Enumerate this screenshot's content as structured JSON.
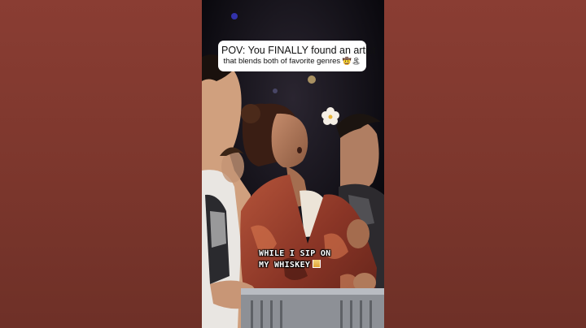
{
  "caption_top": {
    "line1": "POV: You FINALLY found an artist",
    "line2": "that blends both of favorite genres",
    "emoji_1": "🤠",
    "emoji_2": "🏝"
  },
  "caption_bottom": {
    "line1": "WHILE I SIP ON",
    "line2": "MY WHISKEY",
    "emoji": "🥃"
  },
  "colors": {
    "side_panel": "#7d372d",
    "caption_bg": "#ffffff",
    "scene_bg": "#0c0b12"
  }
}
